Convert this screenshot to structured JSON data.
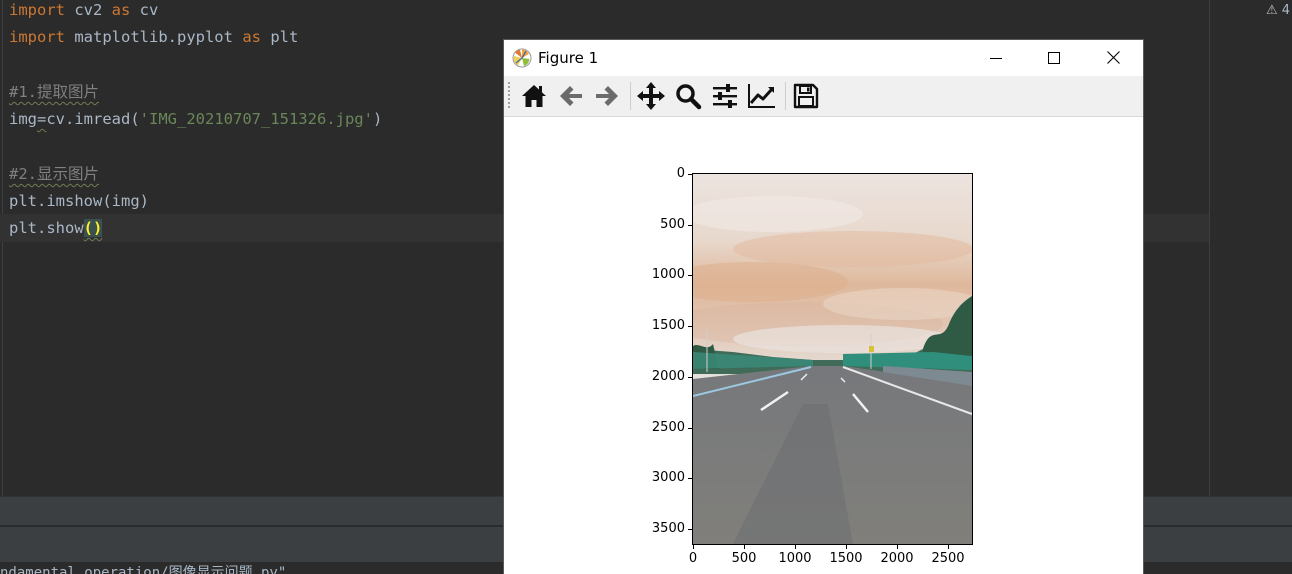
{
  "editor": {
    "lines": {
      "l1": {
        "kw1": "import",
        "mod": " cv2 ",
        "kw2": "as",
        "alias": " cv"
      },
      "l2": {
        "kw1": "import",
        "mod": " matplotlib.pyplot ",
        "kw2": "as",
        "alias": " plt"
      },
      "l4": {
        "comment": "#1.提取图片"
      },
      "l5": {
        "pre": "img",
        "eq": "=",
        "mid": "cv.imread(",
        "str": "'IMG_20210707_151326.jpg'",
        "post": ")"
      },
      "l7": {
        "comment": "#2.显示图片"
      },
      "l8": {
        "text": "plt.imshow(img)"
      },
      "l9": {
        "pre": "plt.show",
        "parens": "()"
      }
    },
    "warning_count": "4"
  },
  "run_panel": {
    "path_text": "ndamental_operation/图像显示问题.py\""
  },
  "figure_window": {
    "title": "Figure 1",
    "buttons": {
      "minimize": "minimize",
      "maximize": "maximize",
      "close": "close"
    },
    "toolbar_icons": [
      "home-icon",
      "back-arrow-icon",
      "forward-arrow-icon",
      "pan-icon",
      "zoom-icon",
      "configure-subplots-icon",
      "edit-axis-icon",
      "save-icon"
    ]
  },
  "chart_data": {
    "type": "image",
    "title": "",
    "xlabel": "",
    "ylabel": "",
    "image_size": {
      "width": 2736,
      "height": 3648
    },
    "x_ticks": [
      0,
      500,
      1000,
      1500,
      2000,
      2500
    ],
    "y_ticks": [
      0,
      500,
      1000,
      1500,
      2000,
      2500,
      3000,
      3500
    ],
    "x_tick_labels": [
      "0",
      "500",
      "1000",
      "1500",
      "2000",
      "2500"
    ],
    "y_tick_labels": [
      "0",
      "500",
      "1000",
      "1500",
      "2000",
      "2500",
      "3000",
      "3500"
    ],
    "xlim": [
      0,
      2736
    ],
    "ylim": [
      3648,
      0
    ],
    "y_axis_inverted": true,
    "content": "photo of an empty asphalt road under a cloudy sky with trees and railings"
  }
}
